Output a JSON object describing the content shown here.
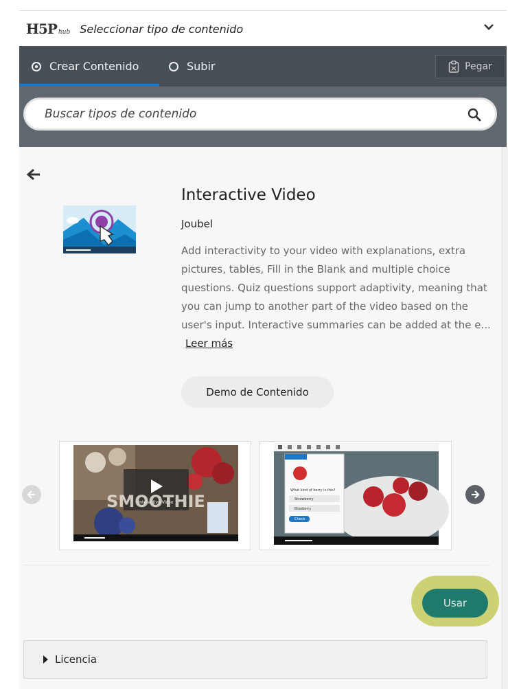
{
  "header": {
    "logo_text": "H5P",
    "logo_sub": "hub",
    "title": "Seleccionar tipo de contenido"
  },
  "tabs": {
    "create_label": "Crear Contenido",
    "upload_label": "Subir",
    "paste_label": "Pegar"
  },
  "search": {
    "placeholder": "Buscar tipos de contenido"
  },
  "content_type": {
    "title": "Interactive Video",
    "author": "Joubel",
    "description": "Add interactivity to your video with explanations, extra pictures, tables, Fill in the Blank and multiple choice questions. Quiz questions support adaptivity, meaning that you can jump to another part of the video based on the user's input. Interactive summaries can be added at the e...",
    "read_more": "Leer más",
    "demo_label": "Demo de Contenido",
    "use_label": "Usar",
    "license_label": "Licencia"
  },
  "screenshots": {
    "shot1_overlay": "Interactive Video",
    "shot1_word": "SMOOTHIE",
    "shot2_question": "What kind of berry is this?",
    "shot2_option1": "Strawberry",
    "shot2_option2": "Blueberry",
    "shot2_check": "Check"
  },
  "colors": {
    "tabbar": "#474f57",
    "searchrow": "#60676f",
    "accent_blue": "#1f77c6",
    "use_button": "#1f7a6c",
    "use_highlight": "#c9cf6c"
  }
}
